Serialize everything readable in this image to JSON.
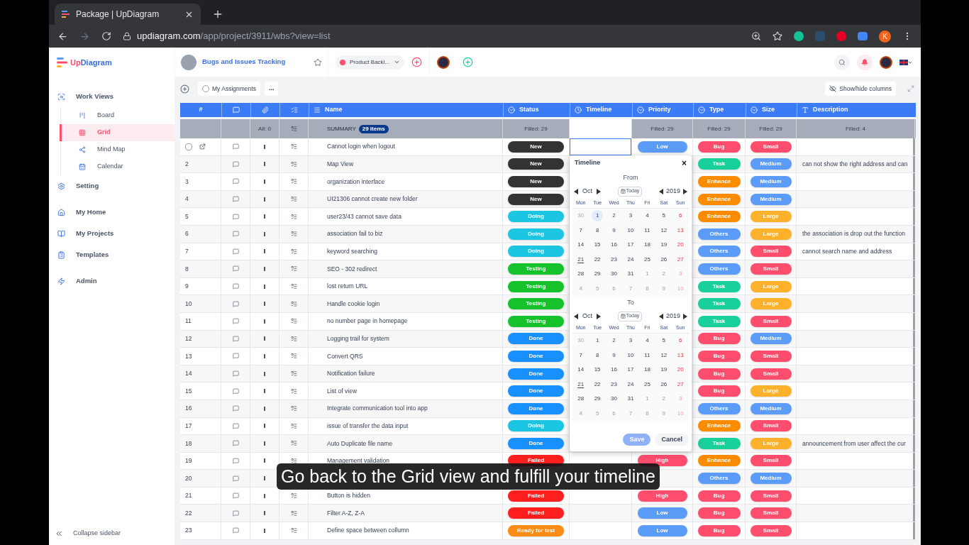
{
  "browser": {
    "tab_title": "Package | UpDiagram",
    "url_host": "updiagram.com",
    "url_path": "/app/project/3911/wbs?view=list",
    "profile_initial": "K"
  },
  "app": {
    "logo": "UpDiagram",
    "project": "Bugs and Issues Tracking",
    "backlog": "Product Backl..."
  },
  "sidebar": {
    "items": [
      {
        "label": "Work Views",
        "selected": false,
        "expanded": true,
        "children": [
          {
            "label": "Board",
            "selected": false
          },
          {
            "label": "Grid",
            "selected": true
          },
          {
            "label": "Mind Map",
            "selected": false
          },
          {
            "label": "Calendar",
            "selected": false
          }
        ]
      },
      {
        "label": "Setting",
        "selected": false
      },
      {
        "label": "My Home",
        "selected": false
      },
      {
        "label": "My Projects",
        "selected": false
      },
      {
        "label": "Templates",
        "selected": false
      },
      {
        "label": "Admin",
        "selected": false
      }
    ],
    "collapse": "Collapse sidebar"
  },
  "toolbar": {
    "assignments": "My Assignments",
    "more": "...",
    "show_hide": "Show/hide columns"
  },
  "table": {
    "columns": [
      {
        "label": "#"
      },
      {},
      {},
      {},
      {
        "label": "Name"
      },
      {
        "label": "Status"
      },
      {
        "label": "Timeline"
      },
      {
        "label": "Priority"
      },
      {
        "label": "Type"
      },
      {
        "label": "Size"
      },
      {
        "label": "Description"
      }
    ],
    "summary": {
      "attachments": "All: 0",
      "title": "SUMMARY",
      "count": "29 items",
      "status": "Filled: 29",
      "priority": "Filled: 29",
      "type": "Filled: 29",
      "size": "Filled: 29",
      "description": "Filled: 4"
    },
    "rows": [
      {
        "checkbox": {
          "checked": false
        },
        "editing": true,
        "name": "Cannot login when logout",
        "status": {
          "label": "New",
          "color": "#333333"
        },
        "priority": {
          "label": "Low",
          "color": "#5b9cf8"
        },
        "type": {
          "label": "Bug",
          "color": "#ff4d6d"
        },
        "size": {
          "label": "Small",
          "color": "#ff4d6d"
        }
      },
      {
        "no": "2",
        "name": "Map View",
        "status": {
          "label": "New",
          "color": "#333333"
        },
        "type": {
          "label": "Task",
          "color": "#19cf9a"
        },
        "size": {
          "label": "Medium",
          "color": "#5b9cf8"
        },
        "description": "can not show the right address and can"
      },
      {
        "no": "3",
        "name": "organization interface",
        "status": {
          "label": "New",
          "color": "#333333"
        },
        "type": {
          "label": "Enhance",
          "color": "#fb8c00"
        },
        "size": {
          "label": "Medium",
          "color": "#5b9cf8"
        }
      },
      {
        "no": "4",
        "name": "UI21306 cannot create new folder",
        "status": {
          "label": "New",
          "color": "#333333"
        },
        "type": {
          "label": "Enhance",
          "color": "#fb8c00"
        },
        "size": {
          "label": "Medium",
          "color": "#5b9cf8"
        }
      },
      {
        "no": "5",
        "name": "user23/43 cannot save data",
        "status": {
          "label": "Doing",
          "color": "#1cc6e3"
        },
        "type": {
          "label": "Enhance",
          "color": "#fb8c00"
        },
        "size": {
          "label": "Large",
          "color": "#ffb12b"
        }
      },
      {
        "no": "6",
        "name": "association fail to biz",
        "status": {
          "label": "Doing",
          "color": "#1cc6e3"
        },
        "type": {
          "label": "Others",
          "color": "#5b9cf8"
        },
        "size": {
          "label": "Large",
          "color": "#ffb12b"
        },
        "description": "the association is drop out the function"
      },
      {
        "no": "7",
        "name": "keyword searching",
        "status": {
          "label": "Doing",
          "color": "#1cc6e3"
        },
        "type": {
          "label": "Others",
          "color": "#5b9cf8"
        },
        "size": {
          "label": "Small",
          "color": "#ff4d6d"
        },
        "description": "cannot search name and address"
      },
      {
        "no": "8",
        "name": "SEO - 302 redirect",
        "status": {
          "label": "Testing",
          "color": "#16c22c"
        },
        "type": {
          "label": "Others",
          "color": "#5b9cf8"
        },
        "size": {
          "label": "Small",
          "color": "#ff4d6d"
        }
      },
      {
        "no": "9",
        "name": "lost return URL",
        "status": {
          "label": "Testing",
          "color": "#16c22c"
        },
        "type": {
          "label": "Task",
          "color": "#19cf9a"
        },
        "size": {
          "label": "Large",
          "color": "#ffb12b"
        }
      },
      {
        "no": "10",
        "name": "Handle cookie login",
        "status": {
          "label": "Testing",
          "color": "#16c22c"
        },
        "type": {
          "label": "Task",
          "color": "#19cf9a"
        },
        "size": {
          "label": "Large",
          "color": "#ffb12b"
        }
      },
      {
        "no": "11",
        "name": "no number page in homepage",
        "status": {
          "label": "Testing",
          "color": "#16c22c"
        },
        "type": {
          "label": "Task",
          "color": "#19cf9a"
        },
        "size": {
          "label": "Small",
          "color": "#ff4d6d"
        }
      },
      {
        "no": "12",
        "name": "Logging trail for system",
        "status": {
          "label": "Done",
          "color": "#1890ff"
        },
        "type": {
          "label": "Bug",
          "color": "#ff4d6d"
        },
        "size": {
          "label": "Medium",
          "color": "#5b9cf8"
        }
      },
      {
        "no": "13",
        "name": "Convert QRS",
        "status": {
          "label": "Done",
          "color": "#1890ff"
        },
        "type": {
          "label": "Bug",
          "color": "#ff4d6d"
        },
        "size": {
          "label": "Small",
          "color": "#ff4d6d"
        }
      },
      {
        "no": "14",
        "name": "Notification failure",
        "status": {
          "label": "Done",
          "color": "#1890ff"
        },
        "type": {
          "label": "Bug",
          "color": "#ff4d6d"
        },
        "size": {
          "label": "Small",
          "color": "#ff4d6d"
        }
      },
      {
        "no": "15",
        "name": "List of view",
        "status": {
          "label": "Done",
          "color": "#1890ff"
        },
        "type": {
          "label": "Bug",
          "color": "#ff4d6d"
        },
        "size": {
          "label": "Large",
          "color": "#ffb12b"
        }
      },
      {
        "no": "16",
        "name": "Integrate communication tool into app",
        "status": {
          "label": "Done",
          "color": "#1890ff"
        },
        "type": {
          "label": "Others",
          "color": "#5b9cf8"
        },
        "size": {
          "label": "Medium",
          "color": "#5b9cf8"
        }
      },
      {
        "no": "17",
        "name": "issue of transfer the data input",
        "status": {
          "label": "Doing",
          "color": "#1cc6e3"
        },
        "type": {
          "label": "Enhance",
          "color": "#fb8c00"
        },
        "size": {
          "label": "Small",
          "color": "#ff4d6d"
        }
      },
      {
        "no": "18",
        "name": "Auto Duplicate file name",
        "status": {
          "label": "Done",
          "color": "#1890ff"
        },
        "type": {
          "label": "Task",
          "color": "#19cf9a"
        },
        "size": {
          "label": "Large",
          "color": "#ffb12b"
        },
        "description": "announcement from user affect the cur"
      },
      {
        "no": "19",
        "editing": false,
        "name": "Management validation",
        "status": {
          "label": "Failed",
          "color": "#ff1f1f"
        },
        "priority": {
          "label": "High",
          "color": "#ff4d6d"
        },
        "type": {
          "label": "Enhance",
          "color": "#fb8c00"
        },
        "size": {
          "label": "Small",
          "color": "#ff4d6d"
        }
      },
      {
        "no": "20",
        "editing": false,
        "type": {
          "label": "Others",
          "color": "#5b9cf8"
        },
        "size": {
          "label": "Medium",
          "color": "#5b9cf8"
        }
      },
      {
        "no": "21",
        "editing": false,
        "name": "Button is hidden",
        "status": {
          "label": "Failed",
          "color": "#ff1f1f"
        },
        "priority": {
          "label": "High",
          "color": "#ff4d6d"
        },
        "type": {
          "label": "Bug",
          "color": "#ff4d6d"
        },
        "size": {
          "label": "Small",
          "color": "#ff4d6d"
        }
      },
      {
        "no": "22",
        "editing": false,
        "name": "Filter A-Z, Z-A",
        "status": {
          "label": "Failed",
          "color": "#ff1f1f"
        },
        "priority": {
          "label": "Low",
          "color": "#5b9cf8"
        },
        "type": {
          "label": "Bug",
          "color": "#ff4d6d"
        },
        "size": {
          "label": "Small",
          "color": "#ff4d6d"
        }
      },
      {
        "no": "23",
        "editing": false,
        "name": "Define space between collumn",
        "status": {
          "label": "Ready for test",
          "color": "#fa8c16"
        },
        "priority": {
          "label": "Low",
          "color": "#5b9cf8"
        },
        "type": {
          "label": "Bug",
          "color": "#ff4d6d"
        },
        "size": {
          "label": "Small",
          "color": "#ff4d6d"
        }
      }
    ]
  },
  "timeline_popup": {
    "title": "Timeline",
    "close": "×",
    "save": "Save",
    "cancel": "Cancel",
    "calendars": [
      {
        "label": "From",
        "month": "Oct",
        "today_button": "Today",
        "year": "2019",
        "weekdays": [
          "Mon",
          "Tue",
          "Wed",
          "Thu",
          "Fri",
          "Sat",
          "Sun"
        ],
        "days": [
          {
            "d": "30",
            "outside": true,
            "selected": false,
            "today": false
          },
          {
            "d": "1",
            "outside": false,
            "selected": true,
            "today": false
          },
          {
            "d": "2",
            "outside": false,
            "selected": false,
            "today": false
          },
          {
            "d": "3",
            "outside": false,
            "selected": false,
            "today": false
          },
          {
            "d": "4",
            "outside": false,
            "selected": false,
            "today": false
          },
          {
            "d": "5",
            "outside": false,
            "selected": false,
            "today": false
          },
          {
            "d": "6",
            "outside": false,
            "selected": false,
            "today": false
          },
          {
            "d": "7",
            "outside": false,
            "selected": false,
            "today": false
          },
          {
            "d": "8",
            "outside": false,
            "selected": false,
            "today": false
          },
          {
            "d": "9",
            "outside": false,
            "selected": false,
            "today": false
          },
          {
            "d": "10",
            "outside": false,
            "selected": false,
            "today": false
          },
          {
            "d": "11",
            "outside": false,
            "selected": false,
            "today": false
          },
          {
            "d": "12",
            "outside": false,
            "selected": false,
            "today": false
          },
          {
            "d": "13",
            "outside": false,
            "selected": false,
            "today": false
          },
          {
            "d": "14",
            "outside": false,
            "selected": false,
            "today": false
          },
          {
            "d": "15",
            "outside": false,
            "selected": false,
            "today": false
          },
          {
            "d": "16",
            "outside": false,
            "selected": false,
            "today": false
          },
          {
            "d": "17",
            "outside": false,
            "selected": false,
            "today": false
          },
          {
            "d": "18",
            "outside": false,
            "selected": false,
            "today": false
          },
          {
            "d": "19",
            "outside": false,
            "selected": false,
            "today": false
          },
          {
            "d": "20",
            "outside": false,
            "selected": false,
            "today": false
          },
          {
            "d": "21",
            "outside": false,
            "selected": false,
            "today": true
          },
          {
            "d": "22",
            "outside": false,
            "selected": false,
            "today": false
          },
          {
            "d": "23",
            "outside": false,
            "selected": false,
            "today": false
          },
          {
            "d": "24",
            "outside": false,
            "selected": false,
            "today": false
          },
          {
            "d": "25",
            "outside": false,
            "selected": false,
            "today": false
          },
          {
            "d": "26",
            "outside": false,
            "selected": false,
            "today": false
          },
          {
            "d": "27",
            "outside": false,
            "selected": false,
            "today": false
          },
          {
            "d": "28",
            "outside": false,
            "selected": false,
            "today": false
          },
          {
            "d": "29",
            "outside": false,
            "selected": false,
            "today": false
          },
          {
            "d": "30",
            "outside": false,
            "selected": false,
            "today": false
          },
          {
            "d": "31",
            "outside": false,
            "selected": false,
            "today": false
          },
          {
            "d": "1",
            "outside": true,
            "selected": false,
            "today": false
          },
          {
            "d": "2",
            "outside": true,
            "selected": false,
            "today": false
          },
          {
            "d": "3",
            "outside": true,
            "selected": false,
            "today": false
          },
          {
            "d": "4",
            "outside": true,
            "selected": false,
            "today": false
          },
          {
            "d": "5",
            "outside": true,
            "selected": false,
            "today": false
          },
          {
            "d": "6",
            "outside": true,
            "selected": false,
            "today": false
          },
          {
            "d": "7",
            "outside": true,
            "selected": false,
            "today": false
          },
          {
            "d": "8",
            "outside": true,
            "selected": false,
            "today": false
          },
          {
            "d": "9",
            "outside": true,
            "selected": false,
            "today": false
          },
          {
            "d": "10",
            "outside": true,
            "selected": false,
            "today": false
          }
        ]
      },
      {
        "label": "To",
        "month": "Oct",
        "today_button": "Today",
        "year": "2019",
        "weekdays": [
          "Mon",
          "Tue",
          "Wed",
          "Thu",
          "Fri",
          "Sat",
          "Sun"
        ],
        "days": [
          {
            "d": "30",
            "outside": true,
            "selected": false,
            "today": false
          },
          {
            "d": "1",
            "outside": false,
            "selected": false,
            "today": false
          },
          {
            "d": "2",
            "outside": false,
            "selected": false,
            "today": false
          },
          {
            "d": "3",
            "outside": false,
            "selected": false,
            "today": false
          },
          {
            "d": "4",
            "outside": false,
            "selected": false,
            "today": false
          },
          {
            "d": "5",
            "outside": false,
            "selected": false,
            "today": false
          },
          {
            "d": "6",
            "outside": false,
            "selected": false,
            "today": false
          },
          {
            "d": "7",
            "outside": false,
            "selected": false,
            "today": false
          },
          {
            "d": "8",
            "outside": false,
            "selected": false,
            "today": false
          },
          {
            "d": "9",
            "outside": false,
            "selected": false,
            "today": false
          },
          {
            "d": "10",
            "outside": false,
            "selected": false,
            "today": false
          },
          {
            "d": "11",
            "outside": false,
            "selected": false,
            "today": false
          },
          {
            "d": "12",
            "outside": false,
            "selected": false,
            "today": false
          },
          {
            "d": "13",
            "outside": false,
            "selected": false,
            "today": false
          },
          {
            "d": "14",
            "outside": false,
            "selected": false,
            "today": false
          },
          {
            "d": "15",
            "outside": false,
            "selected": false,
            "today": false
          },
          {
            "d": "16",
            "outside": false,
            "selected": false,
            "today": false
          },
          {
            "d": "17",
            "outside": false,
            "selected": false,
            "today": false
          },
          {
            "d": "18",
            "outside": false,
            "selected": false,
            "today": false
          },
          {
            "d": "19",
            "outside": false,
            "selected": false,
            "today": false
          },
          {
            "d": "20",
            "outside": false,
            "selected": false,
            "today": false
          },
          {
            "d": "21",
            "outside": false,
            "selected": false,
            "today": true
          },
          {
            "d": "22",
            "outside": false,
            "selected": false,
            "today": false
          },
          {
            "d": "23",
            "outside": false,
            "selected": false,
            "today": false
          },
          {
            "d": "24",
            "outside": false,
            "selected": false,
            "today": false
          },
          {
            "d": "25",
            "outside": false,
            "selected": false,
            "today": false
          },
          {
            "d": "26",
            "outside": false,
            "selected": false,
            "today": false
          },
          {
            "d": "27",
            "outside": false,
            "selected": false,
            "today": false
          },
          {
            "d": "28",
            "outside": false,
            "selected": false,
            "today": false
          },
          {
            "d": "29",
            "outside": false,
            "selected": false,
            "today": false
          },
          {
            "d": "30",
            "outside": false,
            "selected": false,
            "today": false
          },
          {
            "d": "31",
            "outside": false,
            "selected": false,
            "today": false
          },
          {
            "d": "1",
            "outside": true,
            "selected": false,
            "today": false
          },
          {
            "d": "2",
            "outside": true,
            "selected": false,
            "today": false
          },
          {
            "d": "3",
            "outside": true,
            "selected": false,
            "today": false
          },
          {
            "d": "4",
            "outside": true,
            "selected": false,
            "today": false
          },
          {
            "d": "5",
            "outside": true,
            "selected": false,
            "today": false
          },
          {
            "d": "6",
            "outside": true,
            "selected": false,
            "today": false
          },
          {
            "d": "7",
            "outside": true,
            "selected": false,
            "today": false
          },
          {
            "d": "8",
            "outside": true,
            "selected": false,
            "today": false
          },
          {
            "d": "9",
            "outside": true,
            "selected": false,
            "today": false
          },
          {
            "d": "10",
            "outside": true,
            "selected": false,
            "today": false
          }
        ]
      }
    ]
  },
  "caption": "Go back to the Grid view and fulfill your timeline"
}
